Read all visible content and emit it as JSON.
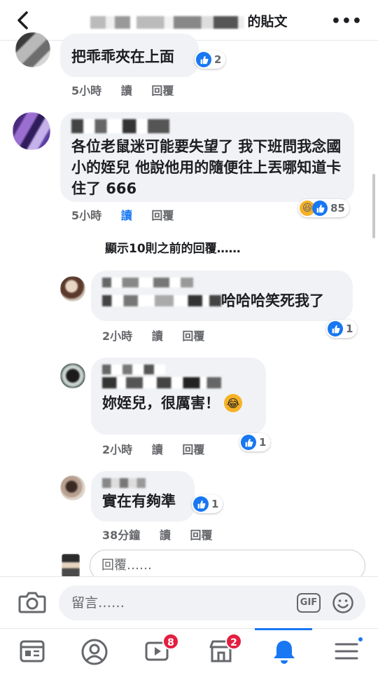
{
  "header": {
    "title_suffix": "的貼文",
    "more": "•••"
  },
  "comments": [
    {
      "text": "把乖乖夾在上面",
      "time": "5小時",
      "read": "讀",
      "reply": "回覆",
      "reaction_count": "2"
    },
    {
      "text": "各位老鼠迷可能要失望了 我下班問我念國小的姪兒 他說他用的隨便往上丟哪知道卡住了 666",
      "time": "5小時",
      "read": "讀",
      "reply": "回覆",
      "reaction_count": "85"
    }
  ],
  "show_more": "顯示10則之前的回覆……",
  "replies": [
    {
      "text": "哈哈哈笑死我了",
      "time": "2小時",
      "read": "讀",
      "reply": "回覆",
      "reaction_count": "1"
    },
    {
      "text": "妳姪兒，很厲害！",
      "time": "2小時",
      "read": "讀",
      "reply": "回覆",
      "reaction_count": "1"
    },
    {
      "text": "實在有夠準",
      "time": "38分鐘",
      "read": "讀",
      "reply": "回覆",
      "reaction_count": "1"
    }
  ],
  "reply_input": {
    "placeholder": "回覆……"
  },
  "composer": {
    "placeholder": "留言……",
    "gif": "GIF"
  },
  "nav": {
    "watch_badge": "8",
    "marketplace_badge": "2"
  },
  "colors": {
    "accent": "#1877f2",
    "badge": "#e41e3f",
    "bubble": "#f0f2f5"
  }
}
